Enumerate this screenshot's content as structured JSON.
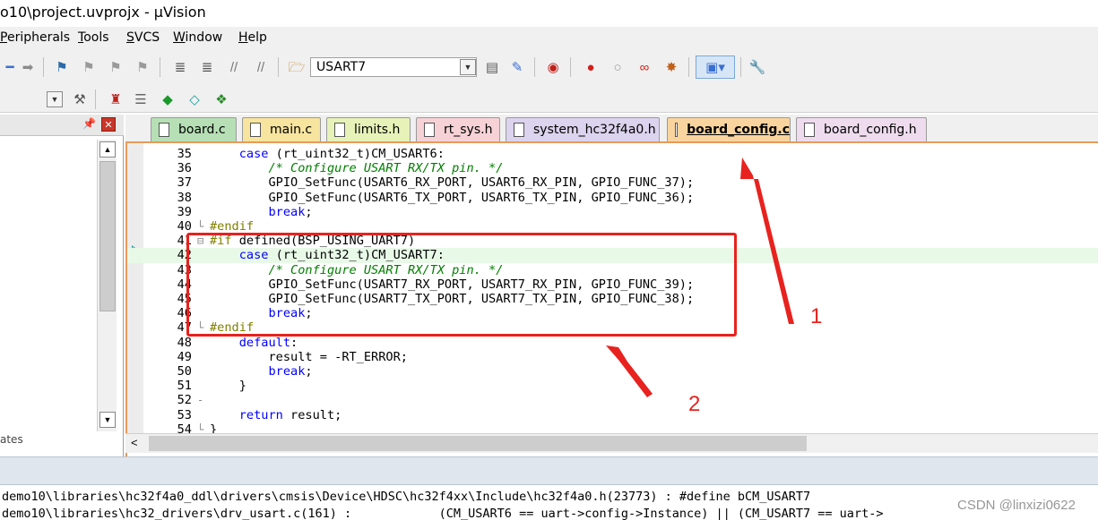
{
  "window": {
    "title": "o10\\project.uvprojx - µVision"
  },
  "menu": {
    "items": [
      {
        "label": "Peripherals",
        "ul": "P",
        "rest": "eripherals"
      },
      {
        "label": "Tools",
        "ul": "T",
        "rest": "ools"
      },
      {
        "label": "SVCS",
        "ul": "S",
        "rest": "VCS"
      },
      {
        "label": "Window",
        "ul": "W",
        "rest": "indow"
      },
      {
        "label": "Help",
        "ul": "H",
        "rest": "elp"
      }
    ]
  },
  "toolbar": {
    "target_combo": "USART7"
  },
  "left_panel": {
    "tab_label": "ates"
  },
  "tabs": [
    {
      "label": "board.c",
      "color": "#b6dfb5"
    },
    {
      "label": "main.c",
      "color": "#f7e49e"
    },
    {
      "label": "limits.h",
      "color": "#e6f2b8"
    },
    {
      "label": "rt_sys.h",
      "color": "#f6d2d6"
    },
    {
      "label": "system_hc32f4a0.h",
      "color": "#dcd3ee"
    },
    {
      "label": "board_config.c",
      "color": "#f9d49f",
      "active": true
    },
    {
      "label": "board_config.h",
      "color": "#eedcee"
    }
  ],
  "code_lines": [
    {
      "n": "35",
      "fold": "",
      "t": "    case (rt_uint32_t)CM_USART6:"
    },
    {
      "n": "36",
      "fold": "",
      "t": "        /* Configure USART RX/TX pin. */"
    },
    {
      "n": "37",
      "fold": "",
      "t": "        GPIO_SetFunc(USART6_RX_PORT, USART6_RX_PIN, GPIO_FUNC_37);"
    },
    {
      "n": "38",
      "fold": "",
      "t": "        GPIO_SetFunc(USART6_TX_PORT, USART6_TX_PIN, GPIO_FUNC_36);"
    },
    {
      "n": "39",
      "fold": "",
      "t": "        break;"
    },
    {
      "n": "40",
      "fold": "└",
      "t": "#endif"
    },
    {
      "n": "41",
      "fold": "⊟",
      "t": "#if defined(BSP_USING_UART7)"
    },
    {
      "n": "42",
      "fold": "",
      "t": "    case (rt_uint32_t)CM_USART7:"
    },
    {
      "n": "43",
      "fold": "",
      "t": "        /* Configure USART RX/TX pin. */"
    },
    {
      "n": "44",
      "fold": "",
      "t": "        GPIO_SetFunc(USART7_RX_PORT, USART7_RX_PIN, GPIO_FUNC_39);"
    },
    {
      "n": "45",
      "fold": "",
      "t": "        GPIO_SetFunc(USART7_TX_PORT, USART7_TX_PIN, GPIO_FUNC_38);"
    },
    {
      "n": "46",
      "fold": "",
      "t": "        break;"
    },
    {
      "n": "47",
      "fold": "└",
      "t": "#endif"
    },
    {
      "n": "48",
      "fold": "",
      "t": "    default:"
    },
    {
      "n": "49",
      "fold": "",
      "t": "        result = -RT_ERROR;"
    },
    {
      "n": "50",
      "fold": "",
      "t": "        break;"
    },
    {
      "n": "51",
      "fold": "",
      "t": "    }"
    },
    {
      "n": "52",
      "fold": "-",
      "t": ""
    },
    {
      "n": "53",
      "fold": "",
      "t": "    return result;"
    },
    {
      "n": "54",
      "fold": "└",
      "t": "}"
    }
  ],
  "current_line": "42",
  "output_lines": [
    "demo10\\libraries\\hc32f4a0_ddl\\drivers\\cmsis\\Device\\HDSC\\hc32f4xx\\Include\\hc32f4a0.h(23773) : #define bCM_USART7",
    "demo10\\libraries\\hc32_drivers\\drv_usart.c(161) :            (CM_USART6 == uart->config->Instance) || (CM_USART7 == uart->"
  ],
  "annotations": {
    "label_1": "1",
    "label_2": "2"
  },
  "watermark": "CSDN @linxizi0622",
  "colors": {
    "accent_border": "#e79a5a",
    "annotation_red": "#e8221e"
  }
}
